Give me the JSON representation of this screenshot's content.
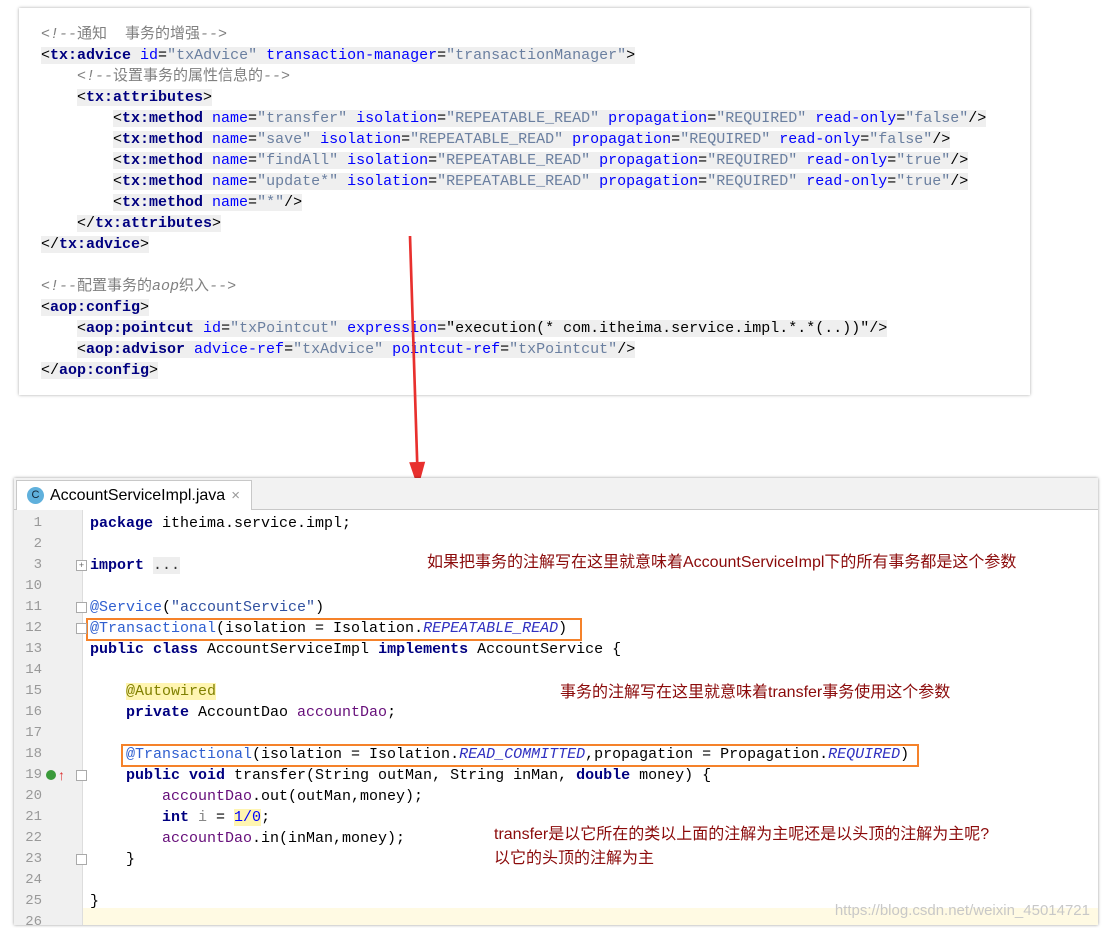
{
  "xml_code": [
    {
      "indent": 0,
      "bg": false,
      "tokens": [
        [
          "cmt",
          "<!--"
        ],
        [
          "cmtz",
          "通知  事务的增强"
        ],
        [
          "cmt",
          "-->"
        ]
      ]
    },
    {
      "indent": 0,
      "bg": true,
      "tokens": [
        [
          "pl",
          "<"
        ],
        [
          "tag",
          "tx:advice "
        ],
        [
          "attr",
          "id"
        ],
        [
          "pl",
          "="
        ],
        [
          "val",
          "\"txAdvice\" "
        ],
        [
          "attr",
          "transaction-manager"
        ],
        [
          "pl",
          "="
        ],
        [
          "val",
          "\"transactionManager\""
        ],
        [
          "pl",
          ">"
        ]
      ]
    },
    {
      "indent": 1,
      "bg": false,
      "tokens": [
        [
          "cmt",
          "<!--"
        ],
        [
          "cmtz",
          "设置事务的属性信息的"
        ],
        [
          "cmt",
          "-->"
        ]
      ]
    },
    {
      "indent": 1,
      "bg": true,
      "tokens": [
        [
          "pl",
          "<"
        ],
        [
          "tag",
          "tx:attributes"
        ],
        [
          "pl",
          ">"
        ]
      ]
    },
    {
      "indent": 2,
      "bg": true,
      "tokens": [
        [
          "pl",
          "<"
        ],
        [
          "tag",
          "tx:method "
        ],
        [
          "attr",
          "name"
        ],
        [
          "pl",
          "="
        ],
        [
          "val",
          "\"transfer\" "
        ],
        [
          "attr",
          "isolation"
        ],
        [
          "pl",
          "="
        ],
        [
          "val",
          "\"REPEATABLE_READ\" "
        ],
        [
          "attr",
          "propagation"
        ],
        [
          "pl",
          "="
        ],
        [
          "val",
          "\"REQUIRED\" "
        ],
        [
          "attr",
          "read-only"
        ],
        [
          "pl",
          "="
        ],
        [
          "val",
          "\"false\""
        ],
        [
          "pl",
          "/>"
        ]
      ]
    },
    {
      "indent": 2,
      "bg": true,
      "tokens": [
        [
          "pl",
          "<"
        ],
        [
          "tag",
          "tx:method "
        ],
        [
          "attr",
          "name"
        ],
        [
          "pl",
          "="
        ],
        [
          "val",
          "\"save\" "
        ],
        [
          "attr",
          "isolation"
        ],
        [
          "pl",
          "="
        ],
        [
          "val",
          "\"REPEATABLE_READ\" "
        ],
        [
          "attr",
          "propagation"
        ],
        [
          "pl",
          "="
        ],
        [
          "val",
          "\"REQUIRED\" "
        ],
        [
          "attr",
          "read-only"
        ],
        [
          "pl",
          "="
        ],
        [
          "val",
          "\"false\""
        ],
        [
          "pl",
          "/>"
        ]
      ]
    },
    {
      "indent": 2,
      "bg": true,
      "tokens": [
        [
          "pl",
          "<"
        ],
        [
          "tag",
          "tx:method "
        ],
        [
          "attr",
          "name"
        ],
        [
          "pl",
          "="
        ],
        [
          "val",
          "\"findAll\" "
        ],
        [
          "attr",
          "isolation"
        ],
        [
          "pl",
          "="
        ],
        [
          "val",
          "\"REPEATABLE_READ\" "
        ],
        [
          "attr",
          "propagation"
        ],
        [
          "pl",
          "="
        ],
        [
          "val",
          "\"REQUIRED\" "
        ],
        [
          "attr",
          "read-only"
        ],
        [
          "pl",
          "="
        ],
        [
          "val",
          "\"true\""
        ],
        [
          "pl",
          "/>"
        ]
      ]
    },
    {
      "indent": 2,
      "bg": true,
      "tokens": [
        [
          "pl",
          "<"
        ],
        [
          "tag",
          "tx:method "
        ],
        [
          "attr",
          "name"
        ],
        [
          "pl",
          "="
        ],
        [
          "val",
          "\"update*\" "
        ],
        [
          "attr",
          "isolation"
        ],
        [
          "pl",
          "="
        ],
        [
          "val",
          "\"REPEATABLE_READ\" "
        ],
        [
          "attr",
          "propagation"
        ],
        [
          "pl",
          "="
        ],
        [
          "val",
          "\"REQUIRED\" "
        ],
        [
          "attr",
          "read-only"
        ],
        [
          "pl",
          "="
        ],
        [
          "val",
          "\"true\""
        ],
        [
          "pl",
          "/>"
        ]
      ]
    },
    {
      "indent": 2,
      "bg": true,
      "tokens": [
        [
          "pl",
          "<"
        ],
        [
          "tag",
          "tx:method "
        ],
        [
          "attr",
          "name"
        ],
        [
          "pl",
          "="
        ],
        [
          "val",
          "\"*\""
        ],
        [
          "pl",
          "/>"
        ]
      ]
    },
    {
      "indent": 1,
      "bg": true,
      "tokens": [
        [
          "pl",
          "</"
        ],
        [
          "tag",
          "tx:attributes"
        ],
        [
          "pl",
          ">"
        ]
      ]
    },
    {
      "indent": 0,
      "bg": true,
      "tokens": [
        [
          "pl",
          "</"
        ],
        [
          "tag",
          "tx:advice"
        ],
        [
          "pl",
          ">"
        ]
      ]
    },
    {
      "indent": 0,
      "bg": false,
      "tokens": []
    },
    {
      "indent": 0,
      "bg": false,
      "tokens": [
        [
          "cmt",
          "<!--"
        ],
        [
          "cmtz",
          "配置事务的"
        ],
        [
          "cmt",
          "aop"
        ],
        [
          "cmtz",
          "织入"
        ],
        [
          "cmt",
          "-->"
        ]
      ]
    },
    {
      "indent": 0,
      "bg": true,
      "tokens": [
        [
          "pl",
          "<"
        ],
        [
          "tag",
          "aop:config"
        ],
        [
          "pl",
          ">"
        ]
      ]
    },
    {
      "indent": 1,
      "bg": true,
      "tokens": [
        [
          "pl",
          "<"
        ],
        [
          "tag",
          "aop:pointcut "
        ],
        [
          "attr",
          "id"
        ],
        [
          "pl",
          "="
        ],
        [
          "val",
          "\"txPointcut\" "
        ],
        [
          "attr",
          "expression"
        ],
        [
          "pl",
          "="
        ],
        [
          "pl",
          "\"execution(* com.itheima.service.impl.*.*(..))\""
        ],
        [
          "pl",
          "/>"
        ]
      ]
    },
    {
      "indent": 1,
      "bg": true,
      "tokens": [
        [
          "pl",
          "<"
        ],
        [
          "tag",
          "aop:advisor "
        ],
        [
          "attr",
          "advice-ref"
        ],
        [
          "pl",
          "="
        ],
        [
          "val",
          "\"txAdvice\" "
        ],
        [
          "attr",
          "pointcut-ref"
        ],
        [
          "pl",
          "="
        ],
        [
          "val",
          "\"txPointcut\""
        ],
        [
          "pl",
          "/>"
        ]
      ]
    },
    {
      "indent": 0,
      "bg": true,
      "tokens": [
        [
          "pl",
          "</"
        ],
        [
          "tag",
          "aop:config"
        ],
        [
          "pl",
          ">"
        ]
      ]
    }
  ],
  "editor": {
    "tab_icon": "C",
    "tab_title": "AccountServiceImpl.java",
    "tab_close": "×",
    "lines": [
      {
        "n": "1",
        "indent": 0,
        "tokens": [
          [
            "kw",
            "package "
          ],
          [
            "pl",
            "itheima.service.impl;"
          ]
        ]
      },
      {
        "n": "2",
        "indent": 0,
        "tokens": []
      },
      {
        "n": "3",
        "indent": 0,
        "fold": "+",
        "tokens": [
          [
            "kw",
            "import "
          ],
          [
            "fold",
            "..."
          ]
        ]
      },
      {
        "n": "10",
        "indent": 0,
        "tokens": []
      },
      {
        "n": "11",
        "indent": 0,
        "fold": "-",
        "tokens": [
          [
            "ann2",
            "@Service"
          ],
          [
            "pl",
            "("
          ],
          [
            "str",
            "\"accountService\""
          ],
          [
            "pl",
            ")"
          ]
        ]
      },
      {
        "n": "12",
        "indent": 0,
        "fold": "-",
        "tokens": [
          [
            "ann2",
            "@Transactional"
          ],
          [
            "pl",
            "(isolation = Isolation."
          ],
          [
            "ital",
            "REPEATABLE_READ"
          ],
          [
            "pl",
            ")"
          ]
        ]
      },
      {
        "n": "13",
        "indent": 0,
        "tokens": [
          [
            "kw",
            "public class "
          ],
          [
            "pl",
            "AccountServiceImpl "
          ],
          [
            "kw",
            "implements "
          ],
          [
            "pl",
            "AccountService {"
          ]
        ]
      },
      {
        "n": "14",
        "indent": 0,
        "tokens": []
      },
      {
        "n": "15",
        "indent": 1,
        "tokens": [
          [
            "annbg",
            "@Autowired"
          ]
        ]
      },
      {
        "n": "16",
        "indent": 1,
        "tokens": [
          [
            "kw",
            "private "
          ],
          [
            "pl",
            "AccountDao "
          ],
          [
            "fld",
            "accountDao"
          ],
          [
            "pl",
            ";"
          ]
        ]
      },
      {
        "n": "17",
        "indent": 1,
        "tokens": []
      },
      {
        "n": "18",
        "indent": 1,
        "tokens": [
          [
            "ann2",
            "@Transactional"
          ],
          [
            "pl",
            "(isolation = Isolation."
          ],
          [
            "ital",
            "READ_COMMITTED"
          ],
          [
            "pl",
            ",propagation = Propagation."
          ],
          [
            "ital",
            "REQUIRED"
          ],
          [
            "pl",
            ")"
          ]
        ]
      },
      {
        "n": "19",
        "indent": 1,
        "fold": "-",
        "marker": true,
        "tokens": [
          [
            "kw",
            "public void "
          ],
          [
            "pl",
            "transfer(String outMan, String inMan, "
          ],
          [
            "kw",
            "double "
          ],
          [
            "pl",
            "money) {"
          ]
        ]
      },
      {
        "n": "20",
        "indent": 2,
        "tokens": [
          [
            "fld",
            "accountDao"
          ],
          [
            "pl",
            ".out(outMan,money);"
          ]
        ]
      },
      {
        "n": "21",
        "indent": 2,
        "tokens": [
          [
            "kw",
            "int "
          ],
          [
            "lv",
            "i"
          ],
          [
            "pl",
            " = "
          ],
          [
            "num",
            "1/0"
          ],
          [
            "pl",
            ";"
          ]
        ]
      },
      {
        "n": "22",
        "indent": 2,
        "tokens": [
          [
            "fld",
            "accountDao"
          ],
          [
            "pl",
            ".in(inMan,money);"
          ]
        ]
      },
      {
        "n": "23",
        "indent": 1,
        "fold": "-",
        "tokens": [
          [
            "pl",
            "}"
          ]
        ]
      },
      {
        "n": "24",
        "indent": 0,
        "tokens": []
      },
      {
        "n": "25",
        "indent": 0,
        "tokens": [
          [
            "pl",
            "}"
          ]
        ]
      },
      {
        "n": "26",
        "indent": 0,
        "tokens": []
      }
    ]
  },
  "annotations": {
    "class_note": "如果把事务的注解写在这里就意味着AccountServiceImpl下的所有事务都是这个参数",
    "method_note": "事务的注解写在这里就意味着transfer事务使用这个参数",
    "question_line1": "transfer是以它所在的类以上面的注解为主呢还是以头顶的注解为主呢?",
    "question_line2": "以它的头顶的注解为主"
  },
  "watermark": "https://blog.csdn.net/weixin_45014721",
  "colors": {
    "arrow": "#e8302e",
    "highlight_box": "#f5822a",
    "note_text": "#8b0a0a"
  }
}
